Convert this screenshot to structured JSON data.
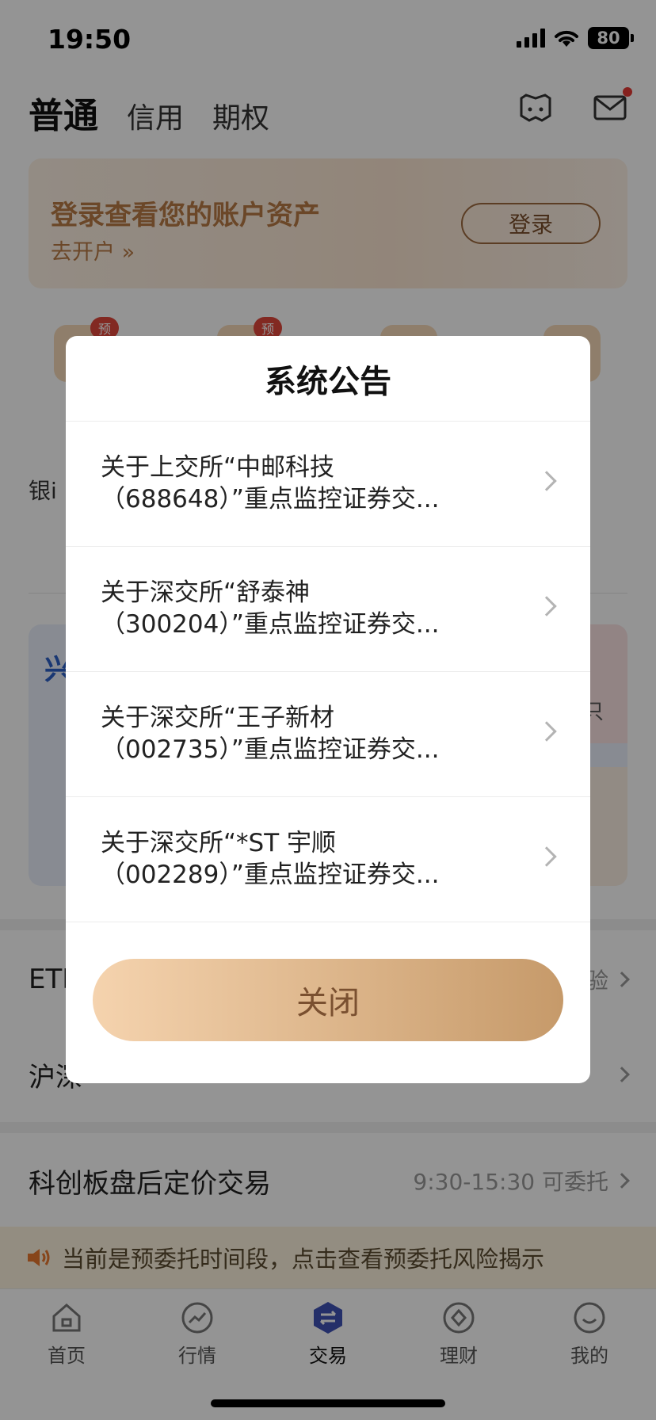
{
  "status_bar": {
    "time": "19:50",
    "battery": "80"
  },
  "header": {
    "tabs": [
      "普通",
      "信用",
      "期权"
    ]
  },
  "login_banner": {
    "title": "登录查看您的账户资产",
    "open_account": "去开户 »",
    "login_button": "登录"
  },
  "grid": {
    "badge": "预",
    "row2_left_partial": "银i"
  },
  "promo": {
    "title_partial": "兴",
    "side_text": "只"
  },
  "rows": [
    {
      "label": "ETF",
      "right": "验"
    },
    {
      "label": "沪深"
    },
    {
      "label": "科创板盘后定价交易",
      "right": "9:30-15:30 可委托"
    }
  ],
  "notice": {
    "text": "当前是预委托时间段，点击查看预委托风险揭示"
  },
  "bottom_nav": [
    {
      "label": "首页",
      "icon": "home-icon"
    },
    {
      "label": "行情",
      "icon": "market-icon"
    },
    {
      "label": "交易",
      "icon": "trade-icon"
    },
    {
      "label": "理财",
      "icon": "finance-icon"
    },
    {
      "label": "我的",
      "icon": "profile-icon"
    }
  ],
  "modal": {
    "title": "系统公告",
    "items": [
      {
        "line1": "关于上交所“中邮科技",
        "line2": "（688648）”重点监控证券交..."
      },
      {
        "line1": "关于深交所“舒泰神",
        "line2": "（300204）”重点监控证券交..."
      },
      {
        "line1": "关于深交所“王子新材",
        "line2": "（002735）”重点监控证券交..."
      },
      {
        "line1": "关于深交所“*ST 宇顺",
        "line2": "（002289）”重点监控证券交..."
      }
    ],
    "close_button": "关闭"
  },
  "colors": {
    "accent_gold": "#c69a6a",
    "trade_blue": "#3f51b5",
    "badge_red": "#e0473b"
  }
}
